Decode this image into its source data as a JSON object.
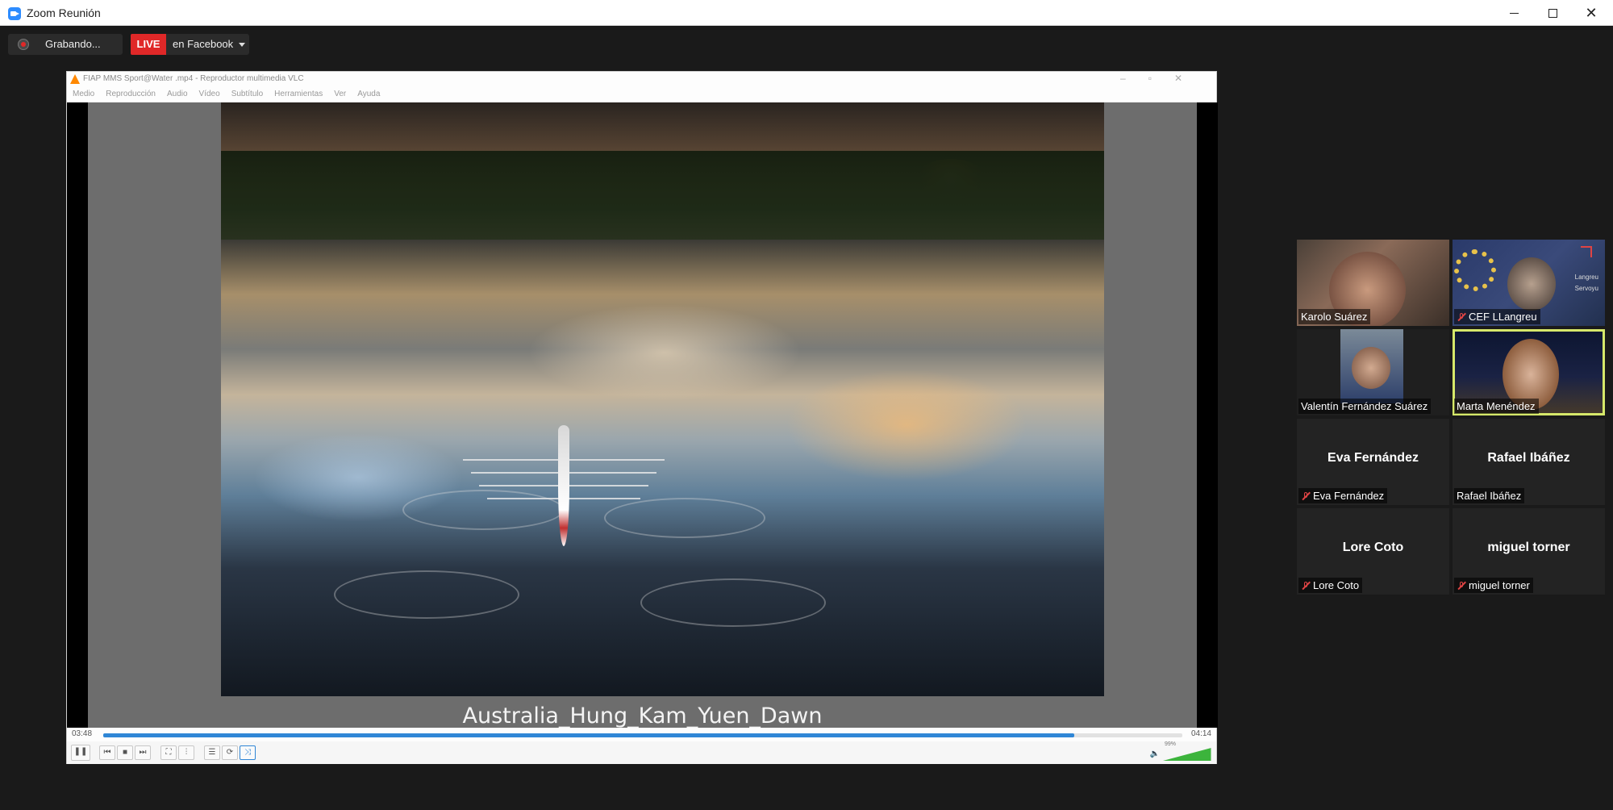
{
  "zoom": {
    "window_title": "Zoom Reunión",
    "recording_label": "Grabando...",
    "live_badge": "LIVE",
    "live_target": "en Facebook"
  },
  "vlc": {
    "title": "FIAP MMS Sport@Water .mp4 - Reproductor multimedia VLC",
    "menu": [
      "Medio",
      "Reproducción",
      "Audio",
      "Vídeo",
      "Subtítulo",
      "Herramientas",
      "Ver",
      "Ayuda"
    ],
    "subtitle_text": "Australia_Hung_Kam_Yuen_Dawn",
    "time_current": "03:48",
    "time_total": "04:14",
    "progress_fraction": 0.9,
    "volume_text": "99%",
    "volume_fraction": 0.99
  },
  "participants": [
    {
      "name": "Karolo Suárez",
      "muted": false,
      "video": true,
      "active": false
    },
    {
      "name": "CEF LLangreu",
      "muted": true,
      "video": true,
      "active": false,
      "side_text": [
        "Langreu",
        "Servoyu"
      ]
    },
    {
      "name": "Valentín Fernández Suárez",
      "muted": false,
      "video": true,
      "active": false
    },
    {
      "name": "Marta Menéndez",
      "muted": false,
      "video": true,
      "active": true
    },
    {
      "name": "Eva Fernández",
      "muted": true,
      "video": false,
      "active": false
    },
    {
      "name": "Rafael Ibáñez",
      "muted": false,
      "video": false,
      "active": false
    },
    {
      "name": "Lore Coto",
      "muted": true,
      "video": false,
      "active": false
    },
    {
      "name": "miguel torner",
      "muted": true,
      "video": false,
      "active": false
    }
  ],
  "colors": {
    "live_red": "#e02828",
    "accent_blue": "#2f86d6",
    "active_speaker": "#d6e86a",
    "muted_red": "#e04444"
  }
}
